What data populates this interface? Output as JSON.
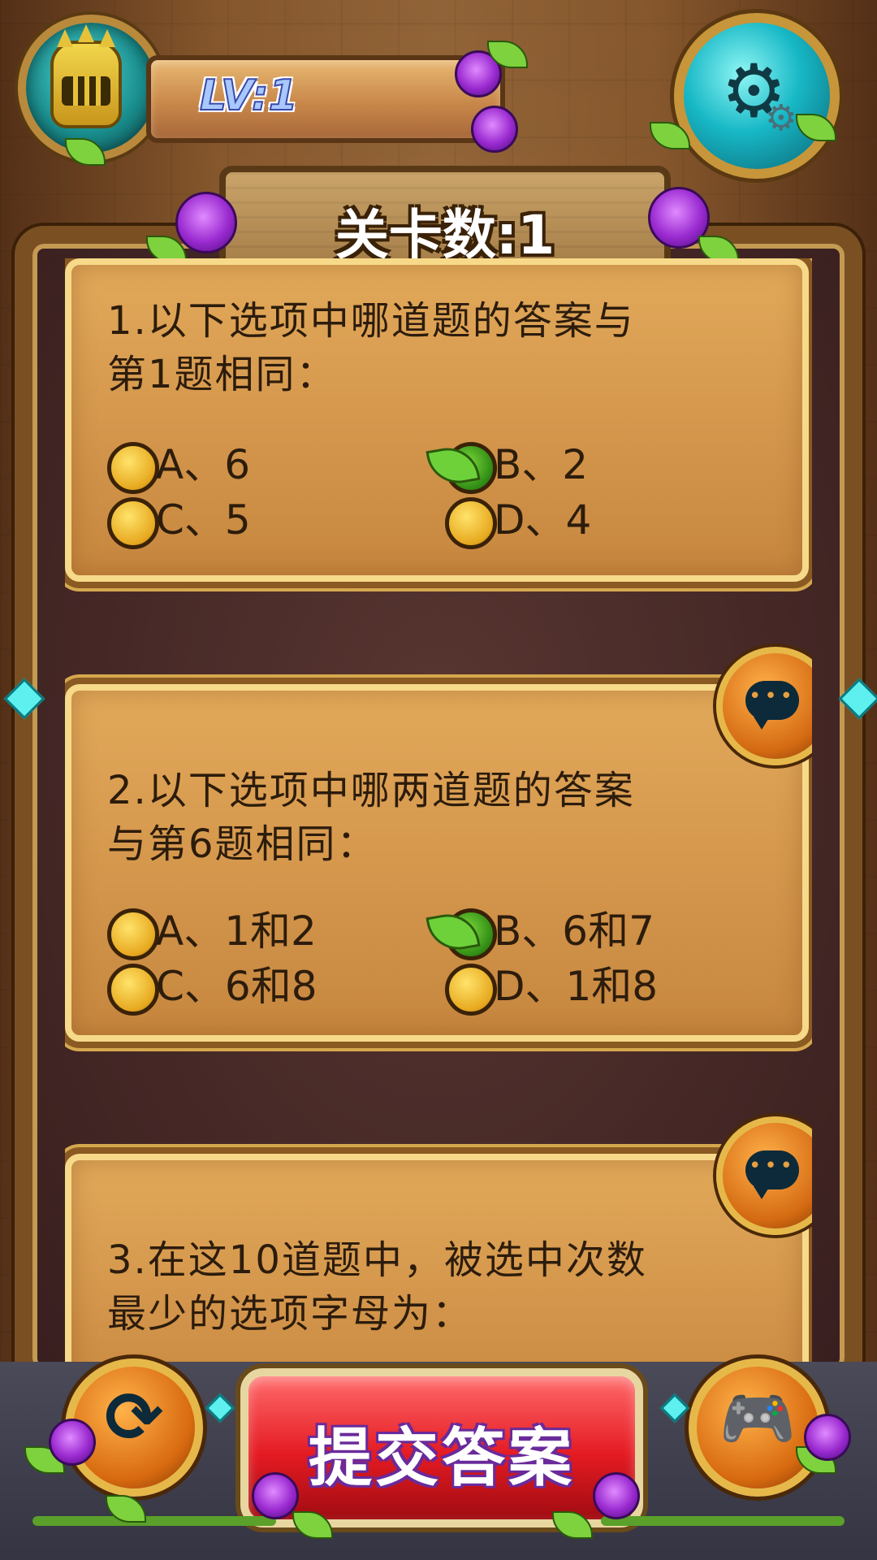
{
  "hud": {
    "level": "LV:1"
  },
  "level_sign": "关卡数:1",
  "questions": [
    {
      "text_line1": "1.以下选项中哪道题的答案与",
      "text_line2": "第1题相同：",
      "options": [
        {
          "label": "A、6",
          "selected": false
        },
        {
          "label": "B、2",
          "selected": true
        },
        {
          "label": "C、5",
          "selected": false
        },
        {
          "label": "D、4",
          "selected": false
        }
      ]
    },
    {
      "text_line1": "2.以下选项中哪两道题的答案",
      "text_line2": "与第6题相同：",
      "options": [
        {
          "label": "A、1和2",
          "selected": false
        },
        {
          "label": "B、6和7",
          "selected": true
        },
        {
          "label": "C、6和8",
          "selected": false
        },
        {
          "label": "D、1和8",
          "selected": false
        }
      ]
    },
    {
      "text_line1": "3.在这10道题中，被选中次数",
      "text_line2": "最少的选项字母为："
    }
  ],
  "buttons": {
    "submit": "提交答案"
  },
  "icons": {
    "settings": "gear-icon",
    "hint": "chat-bubble-icon",
    "reset": "refresh-icon",
    "game": "gamepad-icon"
  },
  "colors": {
    "submit_red": "#e41a22",
    "card_gold": "#d2944a",
    "selected_green": "#2f8a14"
  }
}
